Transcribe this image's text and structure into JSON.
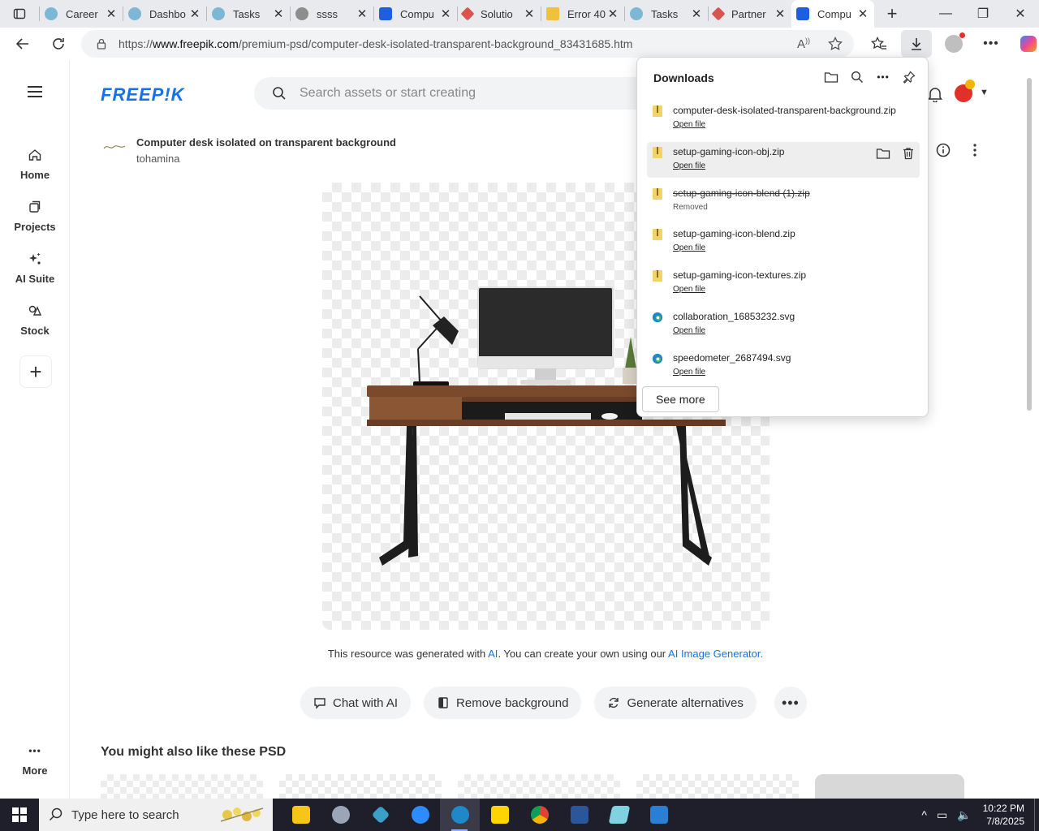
{
  "browser": {
    "tabs": [
      {
        "label": "Career",
        "icon_color": "#7cb8d6"
      },
      {
        "label": "Dashbo",
        "icon_color": "#7cb8d6"
      },
      {
        "label": "Tasks",
        "icon_color": "#7cb8d6"
      },
      {
        "label": "ssss",
        "icon_color": "#8d8d8d"
      },
      {
        "label": "Compu",
        "icon_color": "#1d5fe0"
      },
      {
        "label": "Solutio",
        "icon_color": "#d9534f"
      },
      {
        "label": "Error 40",
        "icon_color": "#f0c040"
      },
      {
        "label": "Tasks",
        "icon_color": "#7cb8d6"
      },
      {
        "label": "Partner",
        "icon_color": "#d9534f"
      },
      {
        "label": "Compu",
        "icon_color": "#1d5fe0"
      }
    ],
    "url_prefix": "https://",
    "url_domain": "www.freepik.com",
    "url_path": "/premium-psd/computer-desk-isolated-transparent-background_83431685.htm",
    "read_aloud_icon": "read-aloud",
    "accent": "#1273eb"
  },
  "site": {
    "logo": "FREEP!K",
    "search_placeholder": "Search assets or start creating",
    "rail": [
      {
        "label": "Home",
        "icon": "home"
      },
      {
        "label": "Projects",
        "icon": "projects"
      },
      {
        "label": "AI Suite",
        "icon": "sparkle"
      },
      {
        "label": "Stock",
        "icon": "stock"
      }
    ],
    "more_label": "More"
  },
  "asset": {
    "title": "Computer desk isolated on transparent background",
    "author": "tohamina",
    "note_prefix": "This resource was generated with",
    "note_ai": "AI",
    "note_mid": ". You can create your own using our",
    "note_gen": "AI Image Generator",
    "note_end": "."
  },
  "actions": {
    "chat": "Chat with AI",
    "remove_bg": "Remove background",
    "alternatives": "Generate alternatives"
  },
  "related_title": "You might also like these PSD",
  "downloads": {
    "title": "Downloads",
    "items": [
      {
        "name": "computer-desk-isolated-transparent-background.zip",
        "status": "Open file",
        "type": "zip"
      },
      {
        "name": "setup-gaming-icon-obj.zip",
        "status": "Open file",
        "type": "zip"
      },
      {
        "name": "setup-gaming-icon-blend (1).zip",
        "status": "Removed",
        "type": "zip"
      },
      {
        "name": "setup-gaming-icon-blend.zip",
        "status": "Open file",
        "type": "zip"
      },
      {
        "name": "setup-gaming-icon-textures.zip",
        "status": "Open file",
        "type": "zip"
      },
      {
        "name": "collaboration_16853232.svg",
        "status": "Open file",
        "type": "edge"
      },
      {
        "name": "speedometer_2687494.svg",
        "status": "Open file",
        "type": "edge"
      }
    ],
    "see_more": "See more"
  },
  "taskbar": {
    "search_placeholder": "Type here to search",
    "time": "10:22 PM",
    "date": "7/8/2025"
  }
}
